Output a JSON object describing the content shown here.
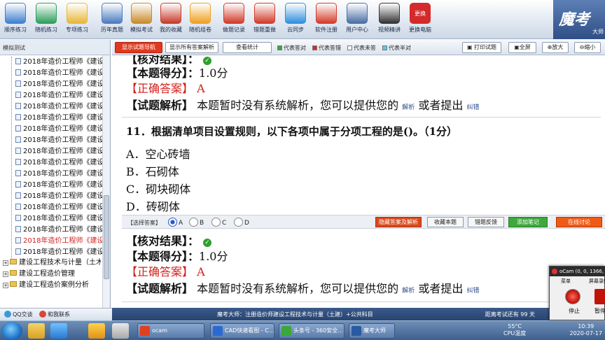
{
  "toolbar": {
    "buttons": [
      {
        "label": "顺序练习",
        "icon": "list-order-icon",
        "color": "#3f7fcf"
      },
      {
        "label": "随机练习",
        "icon": "shuffle-icon",
        "color": "#2e9e5a"
      },
      {
        "label": "专项练习",
        "icon": "folder-icon",
        "color": "#e8b73a"
      },
      {
        "label": "历年真题",
        "icon": "book-stack-icon",
        "color": "#4b7bbf"
      },
      {
        "label": "模拟考试",
        "icon": "exam-pen-icon",
        "color": "#c98b2a"
      },
      {
        "label": "我的收藏",
        "icon": "collection-icon",
        "color": "#c83a2a"
      },
      {
        "label": "随机组卷",
        "icon": "flower-icon",
        "color": "#f0a020"
      },
      {
        "label": "做题记录",
        "icon": "calendar-record-icon",
        "color": "#d23a2a"
      },
      {
        "label": "错题重做",
        "icon": "calendar-redo-icon",
        "color": "#d23a2a"
      },
      {
        "label": "云同步",
        "icon": "cloud-sync-icon",
        "color": "#2f8fdf"
      },
      {
        "label": "软件注册",
        "icon": "lock-icon",
        "color": "#d43b2b"
      },
      {
        "label": "用户中心",
        "icon": "user-icon",
        "color": "#4a6fa5"
      },
      {
        "label": "视频精讲",
        "icon": "video-film-icon",
        "color": "#333333"
      },
      {
        "label": "更换电脑",
        "icon": "swap-computer-icon",
        "color": "#d42a2a"
      }
    ],
    "swap_badge": "更换",
    "brand": "魔考",
    "brand_sub": "大师"
  },
  "sidebar": {
    "title": "模拟测试",
    "item_label": "2018年造价工程师《建设工程",
    "items_count_visible": 18,
    "selected_index": 16,
    "categories": [
      "建设工程技术与计量（土木建筑）",
      "建设工程造价管理",
      "建设工程造价案例分析"
    ]
  },
  "actionbar": {
    "show_card": "显示试题导航",
    "show_all": "显示所有答案解析",
    "stats": "查看统计",
    "legend": [
      {
        "label": "代表答对",
        "color": "#3aa83a"
      },
      {
        "label": "代表答错",
        "color": "#d42a2a"
      },
      {
        "label": "代表未答",
        "color": "#ffffff"
      },
      {
        "label": "代表半对",
        "color": "#5fc7e8"
      }
    ],
    "print": "打印试题",
    "fullscreen": "全屏",
    "zoom_in": "放大",
    "zoom_out": "缩小"
  },
  "prev_result": {
    "check_label": "【核对结果】：",
    "score_label": "【本题得分】：",
    "score": "1.0分",
    "correct_label": "【正确答案】",
    "correct": "A",
    "analysis_label": "【试题解析】",
    "analysis_text": "本题暂时没有系统解析，您可以提供您的",
    "analysis_link": "解析",
    "or_text": "或者提出",
    "error_link": "纠错"
  },
  "question": {
    "title": "11．根据清单项目设置规则，以下各项中属于分项工程的是()。（1分）",
    "options": [
      "A．空心砖墙",
      "B．石砌体",
      "C．砌块砌体",
      "D．砖砌体"
    ],
    "select_label": "【选择答案】",
    "radio_letters": [
      "A",
      "B",
      "C",
      "D"
    ],
    "selected": "A",
    "buttons": {
      "hide": "隐藏答案及解析",
      "collect": "收藏本题",
      "feedback": "错题反馈",
      "note": "添加笔记",
      "discuss": "在线讨论"
    }
  },
  "result": {
    "check_label": "【核对结果】：",
    "score_label": "【本题得分】：",
    "score": "1.0分",
    "correct_label": "【正确答案】",
    "correct": "A",
    "analysis_label": "【试题解析】",
    "analysis_text": "本题暂时没有系统解析，您可以提供您的",
    "analysis_link": "解析",
    "or_text": "或者提出",
    "error_link": "纠错"
  },
  "statusbar": {
    "text": "魔考大师：注册造价师建设工程技术与计量（土建）+公共科目",
    "right": "距离考试还有 99 天"
  },
  "qqbar": {
    "qq": "QQ交谈",
    "contact": "和我联系"
  },
  "taskbar": {
    "windows": [
      {
        "label": "ocam",
        "color": "#e04020"
      },
      {
        "label": "CAD快速看图 - C...",
        "color": "#2a6ad0"
      },
      {
        "label": "头条号 - 360安全...",
        "color": "#3aa83a"
      },
      {
        "label": "魔考大师",
        "color": "#2a5aa0"
      }
    ],
    "temp": "55°C",
    "temp_label": "CPU温度",
    "time": "10:39",
    "date": "2020-07-17"
  },
  "ocam": {
    "title": "oCam (0, 0, 1366, 768)",
    "menu_main": "菜单",
    "menu_record": "屏幕录制",
    "stop": "停止",
    "pause": "暂停"
  }
}
